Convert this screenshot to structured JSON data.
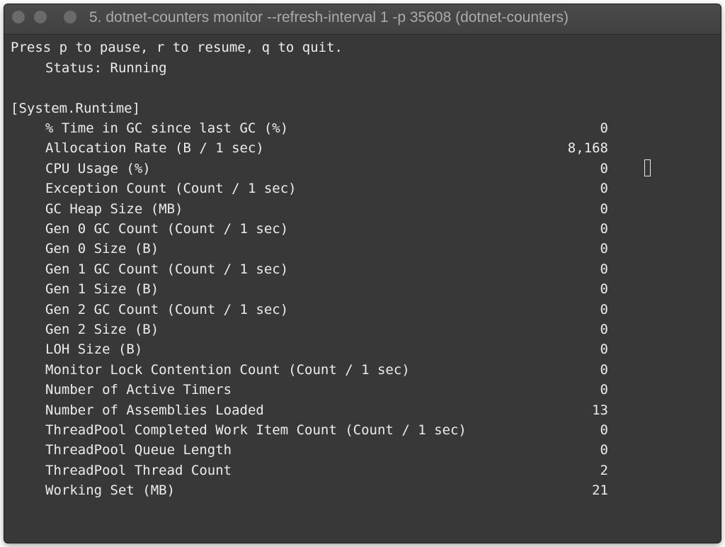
{
  "window": {
    "title": "5. dotnet-counters monitor --refresh-interval 1 -p 35608 (dotnet-counters)"
  },
  "terminal": {
    "help_text": "Press p to pause, r to resume, q to quit.",
    "status_label": "Status:",
    "status_value": "Running",
    "provider": "[System.Runtime]",
    "counters": [
      {
        "label": "% Time in GC since last GC (%)",
        "value": "0"
      },
      {
        "label": "Allocation Rate (B / 1 sec)",
        "value": "8,168"
      },
      {
        "label": "CPU Usage (%)",
        "value": "0"
      },
      {
        "label": "Exception Count (Count / 1 sec)",
        "value": "0"
      },
      {
        "label": "GC Heap Size (MB)",
        "value": "0"
      },
      {
        "label": "Gen 0 GC Count (Count / 1 sec)",
        "value": "0"
      },
      {
        "label": "Gen 0 Size (B)",
        "value": "0"
      },
      {
        "label": "Gen 1 GC Count (Count / 1 sec)",
        "value": "0"
      },
      {
        "label": "Gen 1 Size (B)",
        "value": "0"
      },
      {
        "label": "Gen 2 GC Count (Count / 1 sec)",
        "value": "0"
      },
      {
        "label": "Gen 2 Size (B)",
        "value": "0"
      },
      {
        "label": "LOH Size (B)",
        "value": "0"
      },
      {
        "label": "Monitor Lock Contention Count (Count / 1 sec)",
        "value": "0"
      },
      {
        "label": "Number of Active Timers",
        "value": "0"
      },
      {
        "label": "Number of Assemblies Loaded",
        "value": "13"
      },
      {
        "label": "ThreadPool Completed Work Item Count (Count / 1 sec)",
        "value": "0"
      },
      {
        "label": "ThreadPool Queue Length",
        "value": "0"
      },
      {
        "label": "ThreadPool Thread Count",
        "value": "2"
      },
      {
        "label": "Working Set (MB)",
        "value": "21"
      }
    ]
  }
}
